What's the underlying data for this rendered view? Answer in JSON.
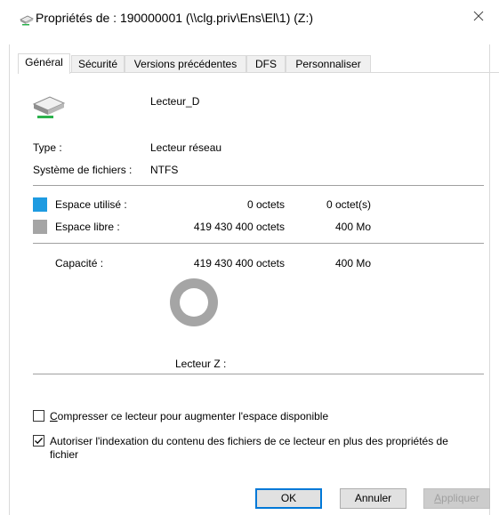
{
  "window": {
    "title": "Propriétés de : 190000001 (\\\\clg.priv\\Ens\\El\\1) (Z:)",
    "close_glyph": "✕"
  },
  "tabs": [
    {
      "label": "Général",
      "active": true
    },
    {
      "label": "Sécurité",
      "active": false
    },
    {
      "label": "Versions précédentes",
      "active": false
    },
    {
      "label": "DFS",
      "active": false
    },
    {
      "label": "Personnaliser",
      "active": false
    }
  ],
  "general": {
    "drive_name": "Lecteur_D",
    "type_label": "Type :",
    "type_value": "Lecteur réseau",
    "fs_label": "Système de fichiers :",
    "fs_value": "NTFS",
    "used": {
      "label": "Espace utilisé :",
      "bytes": "0 octets",
      "human": "0 octet(s)",
      "color": "#1e9be1"
    },
    "free": {
      "label": "Espace libre :",
      "bytes": "419 430 400 octets",
      "human": "400 Mo",
      "color": "#a5a5a5"
    },
    "capacity": {
      "label": "Capacité :",
      "bytes": "419 430 400 octets",
      "human": "400 Mo"
    },
    "donut_used_fraction": 0,
    "drive_caption": "Lecteur Z :"
  },
  "options": {
    "compress": {
      "label": "Compresser ce lecteur pour augmenter l'espace disponible",
      "checked": false
    },
    "index": {
      "label_line1": "Autoriser l'indexation du contenu des fichiers de ce lecteur en plus des propriétés de",
      "label_line2": "fichier",
      "checked": true
    }
  },
  "buttons": {
    "ok": "OK",
    "cancel": "Annuler",
    "apply": "Appliquer"
  },
  "icons": {
    "title": "network-drive-icon",
    "drive": "network-drive-icon",
    "close": "close-icon"
  }
}
